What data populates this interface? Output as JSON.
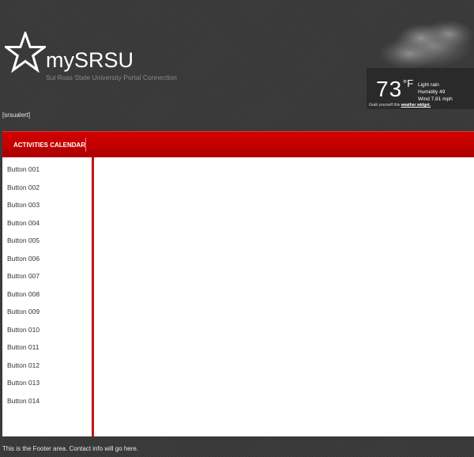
{
  "header": {
    "brand": "mySRSU",
    "tagline": "Sul Ross State University Portal Connection",
    "alert": "[srsualert]"
  },
  "weather": {
    "temperature": "73",
    "unit": "°F",
    "condition": "Light rain",
    "humidity": "Humidity 49",
    "wind": "Wind 7.81 mph",
    "credit_prefix": "Grab yourself this",
    "credit_link": "weather widget."
  },
  "nav": {
    "items": [
      {
        "label": "ACTIVITIES CALENDAR"
      }
    ]
  },
  "sidebar": {
    "buttons": [
      "Button 001",
      "Button 002",
      "Button 003",
      "Button 004",
      "Button 005",
      "Button 006",
      "Button 007",
      "Button 008",
      "Button 009",
      "Button 010",
      "Button 011",
      "Button 012",
      "Button 013",
      "Button 014"
    ]
  },
  "footer": {
    "text": "This is the Footer area. Contact info will go here."
  },
  "colors": {
    "background": "#3a3a3a",
    "accent": "#c00000",
    "content": "#ffffff"
  }
}
